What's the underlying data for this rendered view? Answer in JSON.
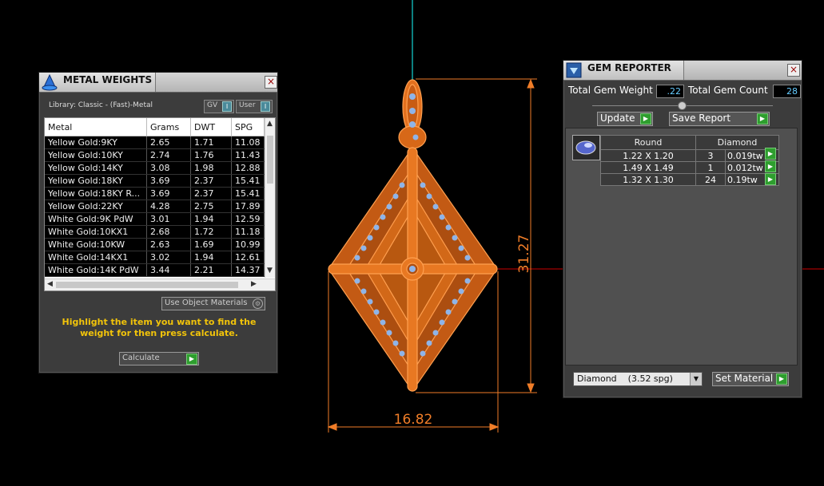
{
  "viewport": {
    "dim_height": "31.27",
    "dim_width": "16.82",
    "accent_color": "#f07d28"
  },
  "metal_weights": {
    "title": "METAL WEIGHTS",
    "close": "×",
    "library_label": "Library: Classic - (Fast)-Metal",
    "toggle_gv": "GV",
    "toggle_user": "User",
    "columns": [
      "Metal",
      "Grams",
      "DWT",
      "SPG"
    ],
    "rows": [
      [
        "Yellow Gold:9KY",
        "2.65",
        "1.71",
        "11.08"
      ],
      [
        "Yellow Gold:10KY",
        "2.74",
        "1.76",
        "11.43"
      ],
      [
        "Yellow Gold:14KY",
        "3.08",
        "1.98",
        "12.88"
      ],
      [
        "Yellow Gold:18KY",
        "3.69",
        "2.37",
        "15.41"
      ],
      [
        "Yellow Gold:18KY R...",
        "3.69",
        "2.37",
        "15.41"
      ],
      [
        "Yellow Gold:22KY",
        "4.28",
        "2.75",
        "17.89"
      ],
      [
        "White Gold:9K PdW",
        "3.01",
        "1.94",
        "12.59"
      ],
      [
        "White Gold:10KX1",
        "2.68",
        "1.72",
        "11.18"
      ],
      [
        "White Gold:10KW",
        "2.63",
        "1.69",
        "10.99"
      ],
      [
        "White Gold:14KX1",
        "3.02",
        "1.94",
        "12.61"
      ],
      [
        "White Gold:14K PdW",
        "3.44",
        "2.21",
        "14.37"
      ]
    ],
    "use_object_materials": "Use Object Materials",
    "hint": "Highlight the item you want to find the weight for then press calculate.",
    "calculate": "Calculate"
  },
  "gem_reporter": {
    "title": "GEM REPORTER",
    "close": "×",
    "total_weight_label": "Total Gem Weight",
    "total_weight_value": ".22",
    "total_count_label": "Total Gem Count",
    "total_count_value": "28",
    "update": "Update",
    "save_report": "Save Report",
    "headers": [
      "Round",
      "Diamond"
    ],
    "rows": [
      [
        "1.22 X 1.20",
        "3",
        "0.019tw"
      ],
      [
        "1.49 X 1.49",
        "1",
        "0.012tw"
      ],
      [
        "1.32 X 1.30",
        "24",
        "0.19tw"
      ]
    ],
    "material": "Diamond    (3.52 spg)",
    "set_material": "Set Material"
  }
}
